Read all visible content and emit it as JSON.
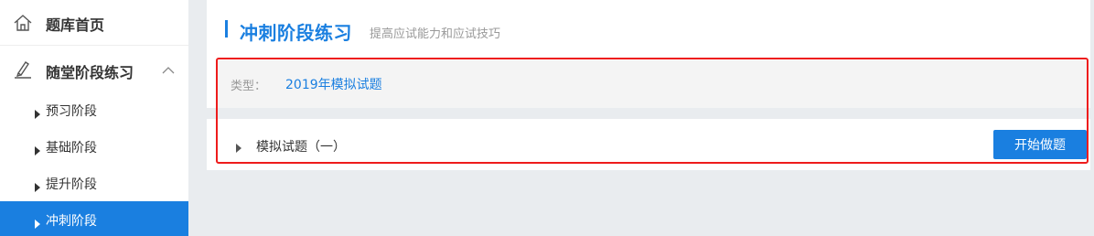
{
  "sidebar": {
    "home": {
      "label": "题库首页",
      "icon": "home-icon"
    },
    "group": {
      "label": "随堂阶段练习",
      "icon": "pencil-icon",
      "expanded": true
    },
    "items": [
      {
        "label": "预习阶段"
      },
      {
        "label": "基础阶段"
      },
      {
        "label": "提升阶段"
      },
      {
        "label": "冲刺阶段",
        "active": true
      }
    ]
  },
  "main": {
    "title": "冲刺阶段练习",
    "subtitle": "提高应试能力和应试技巧",
    "type_label": "类型：",
    "type_value": "2019年模拟试题",
    "exam_title": "模拟试题（一）",
    "start_button": "开始做题"
  },
  "colors": {
    "accent": "#1a7fe0",
    "highlight": "#ee1c1c",
    "background": "#e9ecef"
  }
}
